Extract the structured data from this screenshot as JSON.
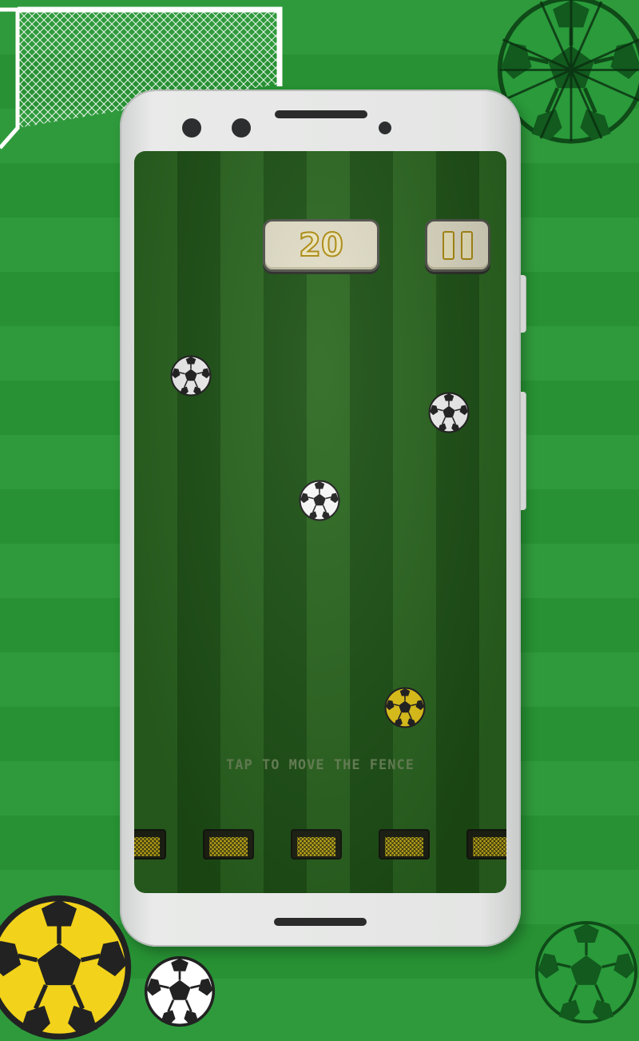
{
  "game": {
    "score": "20",
    "hint": "TAP TO MOVE THE FENCE"
  },
  "hud": {
    "pause_icon": "pause-icon"
  },
  "colors": {
    "field_light": "#2d6a22",
    "field_dark": "#1f5417",
    "background_green": "#2f9a3c",
    "hud_fill": "#e6e2cb",
    "hud_text": "#b28f12",
    "yellow_ball": "#f2d21b"
  }
}
